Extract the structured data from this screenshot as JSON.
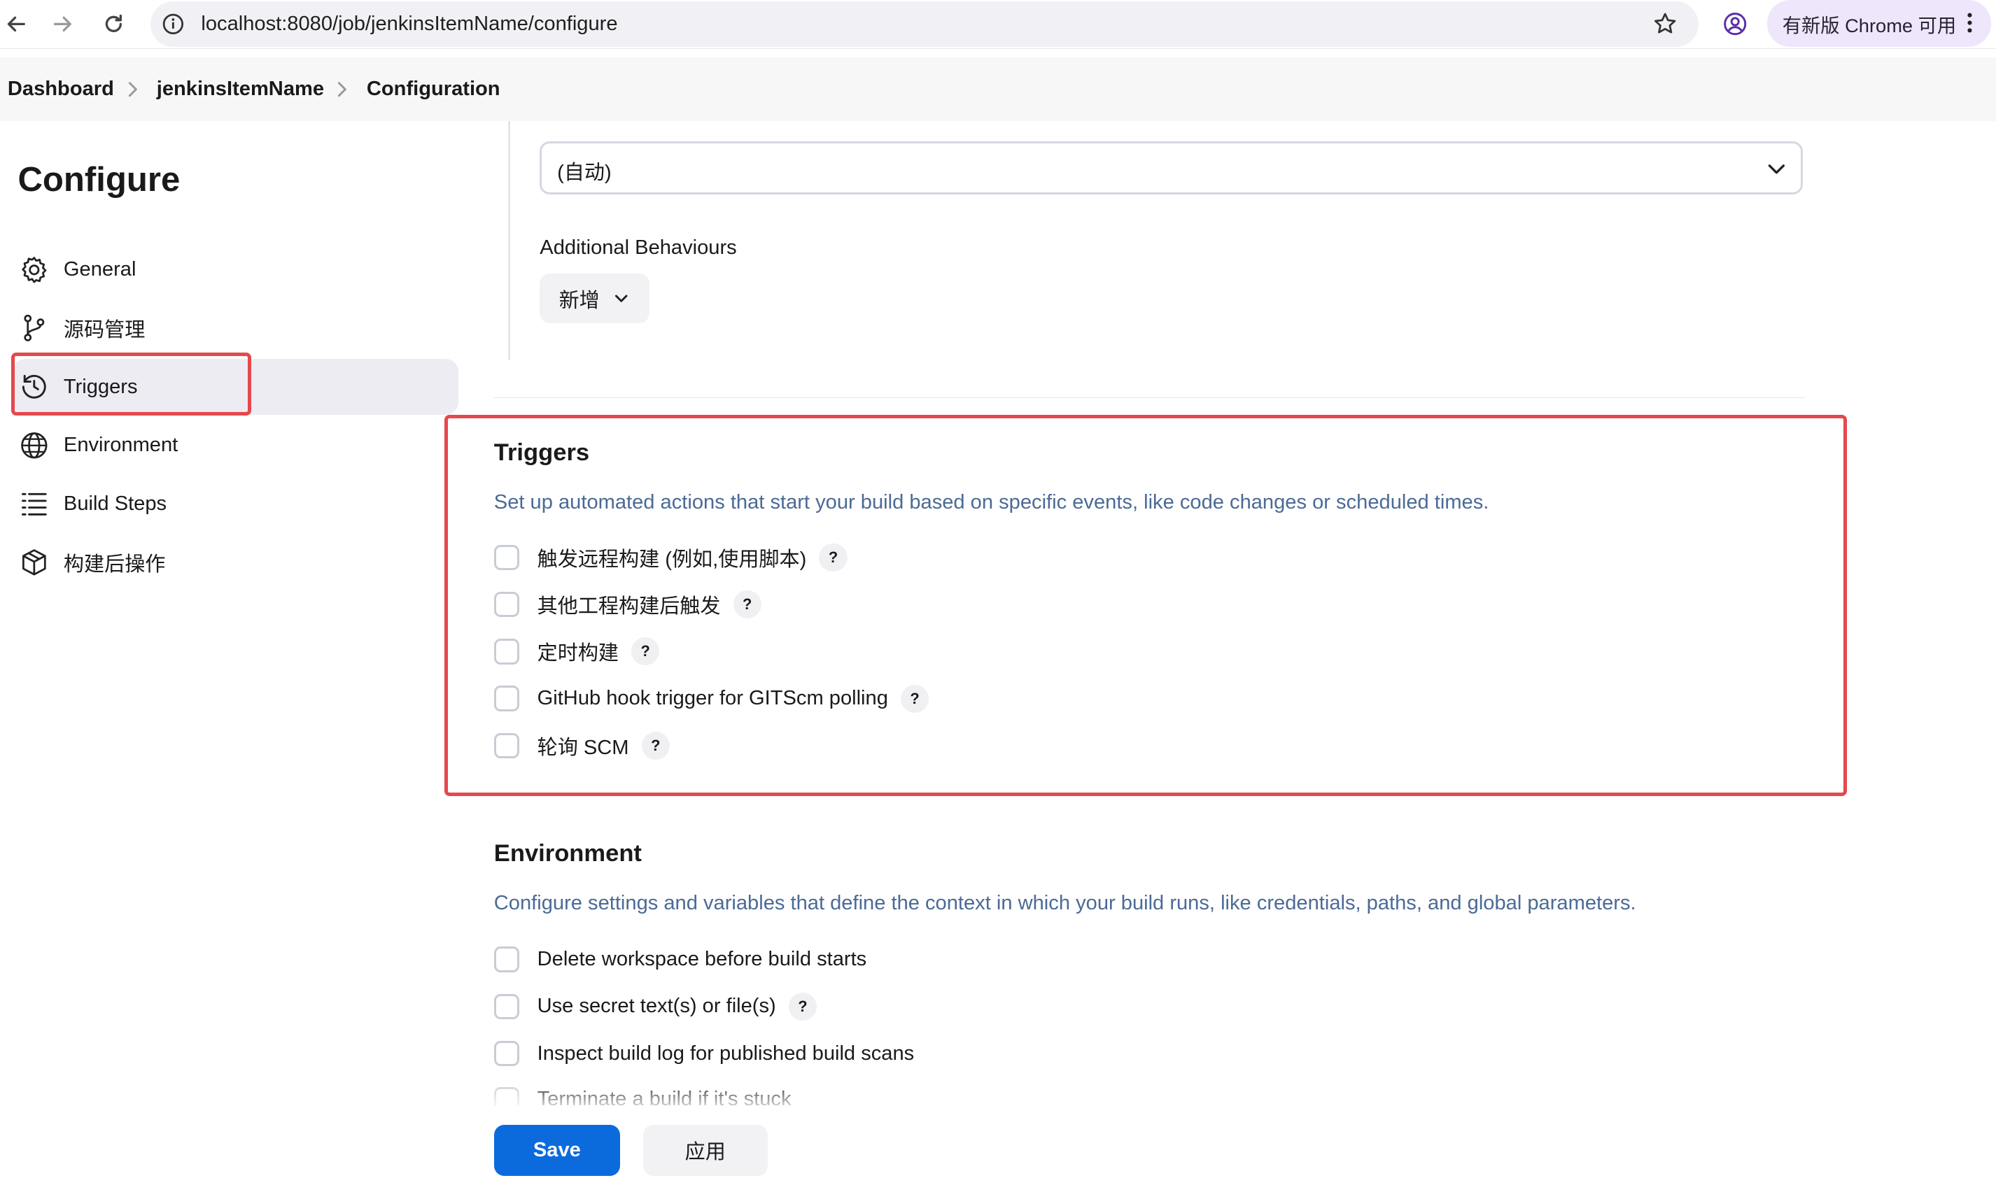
{
  "browser": {
    "url": "localhost:8080/job/jenkinsItemName/configure",
    "update_label": "有新版 Chrome 可用"
  },
  "breadcrumb": [
    "Dashboard",
    "jenkinsItemName",
    "Configuration"
  ],
  "sidebar": {
    "title": "Configure",
    "items": [
      {
        "label": "General",
        "icon": "gear-icon"
      },
      {
        "label": "源码管理",
        "icon": "branch-icon"
      },
      {
        "label": "Triggers",
        "icon": "clock-icon",
        "active": true
      },
      {
        "label": "Environment",
        "icon": "globe-icon"
      },
      {
        "label": "Build Steps",
        "icon": "list-icon"
      },
      {
        "label": "构建后操作",
        "icon": "package-icon"
      }
    ]
  },
  "scm": {
    "browser_select_value": "(自动)",
    "additional_behaviours_label": "Additional Behaviours",
    "add_button_label": "新增"
  },
  "triggers": {
    "title": "Triggers",
    "description": "Set up automated actions that start your build based on specific events, like code changes or scheduled times.",
    "options": [
      {
        "label": "触发远程构建 (例如,使用脚本)",
        "checked": false,
        "help": true
      },
      {
        "label": "其他工程构建后触发",
        "checked": false,
        "help": true
      },
      {
        "label": "定时构建",
        "checked": false,
        "help": true
      },
      {
        "label": "GitHub hook trigger for GITScm polling",
        "checked": false,
        "help": true
      },
      {
        "label": "轮询 SCM",
        "checked": false,
        "help": true
      }
    ]
  },
  "environment": {
    "title": "Environment",
    "description": "Configure settings and variables that define the context in which your build runs, like credentials, paths, and global parameters.",
    "options": [
      {
        "label": "Delete workspace before build starts",
        "checked": false,
        "help": false
      },
      {
        "label": "Use secret text(s) or file(s)",
        "checked": false,
        "help": true
      },
      {
        "label": "Inspect build log for published build scans",
        "checked": false,
        "help": false
      },
      {
        "label": "Terminate a build if it's stuck",
        "checked": false,
        "help": false
      }
    ]
  },
  "actions": {
    "save_label": "Save",
    "apply_label": "应用"
  },
  "help_glyph": "?",
  "colors": {
    "primary_button": "#0b6bdc",
    "annotation_red": "#e5484d",
    "description_text": "#4b6a96",
    "active_nav_bg": "#ececf2"
  }
}
